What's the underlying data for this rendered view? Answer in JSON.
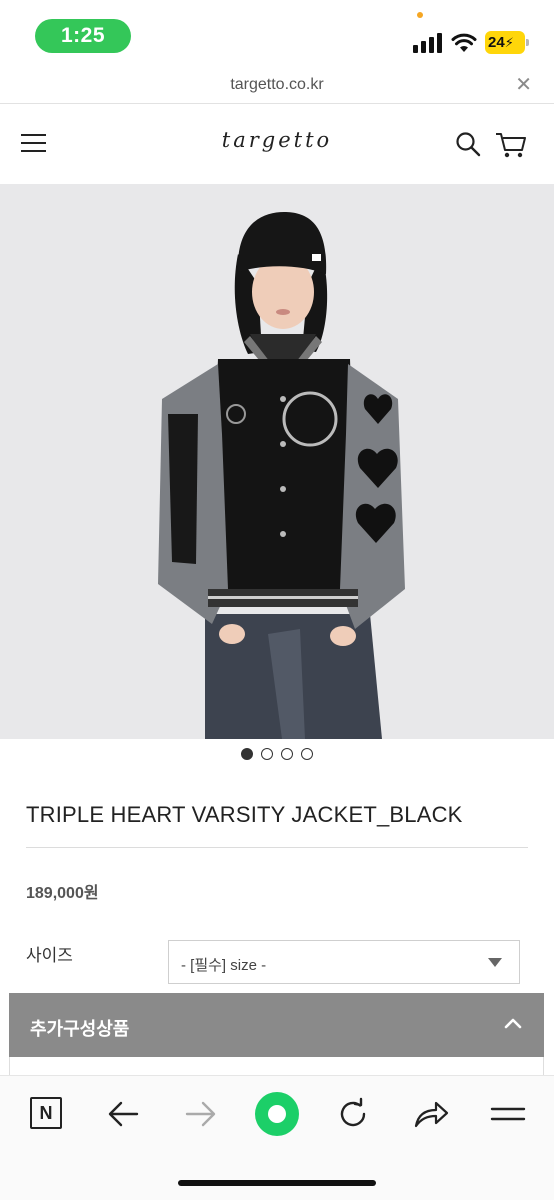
{
  "status_bar": {
    "time": "1:25",
    "battery": "24",
    "colors": {
      "time_pill": "#34c759",
      "battery": "#ffd60a",
      "dot": "#f5a623"
    }
  },
  "browser": {
    "url": "targetto.co.kr",
    "close_icon": "close-icon"
  },
  "header": {
    "logo": "targetto",
    "icons": [
      "menu-icon",
      "search-icon",
      "cart-icon"
    ]
  },
  "product": {
    "image_alt": "model wearing black varsity jacket with grey leather sleeves",
    "carousel": {
      "count": 4,
      "active": 1
    },
    "title": "TRIPLE HEART VARSITY JACKET_BLACK",
    "price": "189,000원",
    "size_label": "사이즈",
    "size_select_value": "- [필수] size -",
    "addon_label": "추가구성상품"
  },
  "toolbar": {
    "naver_label": "N",
    "icons": [
      "naver-icon",
      "back-arrow-icon",
      "forward-arrow-icon",
      "home-icon",
      "refresh-icon",
      "share-icon",
      "menu-icon"
    ],
    "colors": {
      "home": "#1ccf68"
    }
  }
}
